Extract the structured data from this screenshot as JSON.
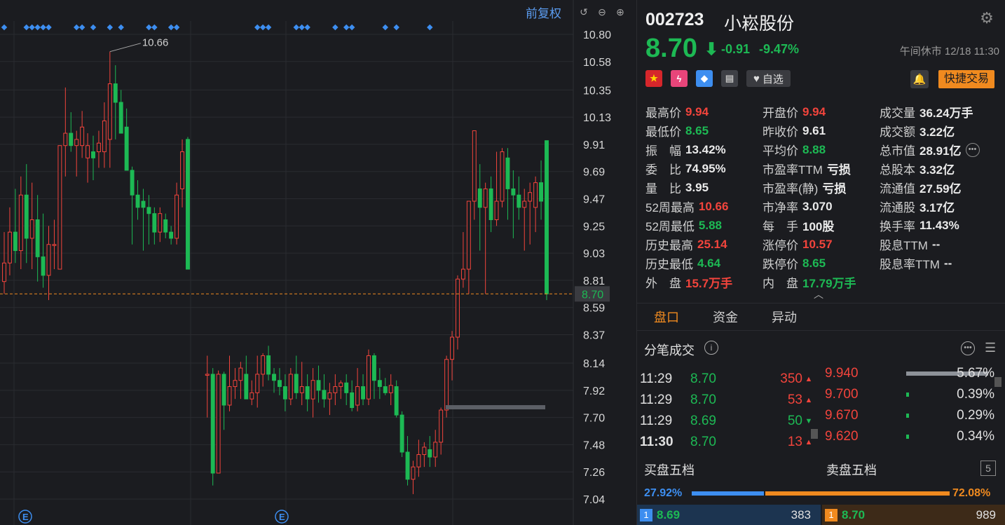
{
  "chart": {
    "toolbar": {
      "adjust_label": "前复权"
    },
    "y_ticks": [
      "10.80",
      "10.58",
      "10.35",
      "10.13",
      "9.91",
      "9.69",
      "9.47",
      "9.25",
      "9.03",
      "8.81",
      "8.59",
      "8.37",
      "8.14",
      "7.92",
      "7.70",
      "7.48",
      "7.26",
      "7.04"
    ],
    "current_price_label": "8.70",
    "high_annotation": "10.66",
    "event_marker": "E",
    "colors": {
      "up": "#f2443c",
      "down": "#1db954",
      "dot": "#3d8ef0"
    }
  },
  "chart_data": {
    "type": "candlestick",
    "ylim": [
      7.04,
      10.8
    ],
    "current_price": 8.7,
    "high_mark": 10.66,
    "candles": [
      {
        "o": 8.8,
        "h": 9.2,
        "l": 8.7,
        "c": 8.95
      },
      {
        "o": 8.95,
        "h": 9.4,
        "l": 8.85,
        "c": 9.2
      },
      {
        "o": 9.2,
        "h": 9.55,
        "l": 8.95,
        "c": 9.05
      },
      {
        "o": 9.05,
        "h": 9.65,
        "l": 8.9,
        "c": 9.5
      },
      {
        "o": 9.5,
        "h": 9.75,
        "l": 8.95,
        "c": 9.15
      },
      {
        "o": 9.15,
        "h": 9.6,
        "l": 8.9,
        "c": 9.3
      },
      {
        "o": 9.3,
        "h": 9.5,
        "l": 8.8,
        "c": 9.0
      },
      {
        "o": 9.0,
        "h": 9.35,
        "l": 8.75,
        "c": 8.85
      },
      {
        "o": 8.85,
        "h": 9.25,
        "l": 8.65,
        "c": 9.1
      },
      {
        "o": 9.1,
        "h": 9.3,
        "l": 8.9,
        "c": 9.1
      },
      {
        "o": 8.9,
        "h": 9.9,
        "l": 8.9,
        "c": 9.9
      },
      {
        "o": 9.9,
        "h": 10.37,
        "l": 9.65,
        "c": 10.0
      },
      {
        "o": 10.0,
        "h": 10.17,
        "l": 9.85,
        "c": 9.9
      },
      {
        "o": 9.9,
        "h": 10.02,
        "l": 9.65,
        "c": 9.95
      },
      {
        "o": 9.9,
        "h": 10.18,
        "l": 9.8,
        "c": 10.05
      },
      {
        "o": 9.8,
        "h": 10.0,
        "l": 9.6,
        "c": 9.9
      },
      {
        "o": 9.85,
        "h": 9.98,
        "l": 9.62,
        "c": 9.8
      },
      {
        "o": 9.85,
        "h": 10.02,
        "l": 9.72,
        "c": 9.92
      },
      {
        "o": 9.85,
        "h": 10.25,
        "l": 9.72,
        "c": 10.1
      },
      {
        "o": 9.95,
        "h": 10.66,
        "l": 9.72,
        "c": 10.4
      },
      {
        "o": 10.4,
        "h": 10.55,
        "l": 9.95,
        "c": 10.25
      },
      {
        "o": 10.25,
        "h": 10.35,
        "l": 10.0,
        "c": 10.0
      },
      {
        "o": 10.05,
        "h": 10.2,
        "l": 9.8,
        "c": 9.7
      },
      {
        "o": 9.7,
        "h": 9.73,
        "l": 9.1,
        "c": 9.5
      },
      {
        "o": 9.5,
        "h": 9.62,
        "l": 9.3,
        "c": 9.4
      },
      {
        "o": 9.45,
        "h": 9.55,
        "l": 9.05,
        "c": 9.4
      },
      {
        "o": 9.4,
        "h": 9.5,
        "l": 9.1,
        "c": 9.35
      },
      {
        "o": 9.35,
        "h": 9.4,
        "l": 9.1,
        "c": 9.2
      },
      {
        "o": 9.2,
        "h": 9.4,
        "l": 9.12,
        "c": 9.35
      },
      {
        "o": 9.3,
        "h": 9.35,
        "l": 9.15,
        "c": 9.2
      },
      {
        "o": 9.2,
        "h": 9.25,
        "l": 9.1,
        "c": 9.15
      },
      {
        "o": 9.15,
        "h": 9.6,
        "l": 9.1,
        "c": 9.5
      },
      {
        "o": 9.55,
        "h": 9.95,
        "l": 9.4,
        "c": 9.85
      },
      {
        "o": 9.95,
        "h": 9.97,
        "l": 8.9,
        "c": 8.9
      },
      {
        "o": 8.05,
        "h": 8.2,
        "l": 7.7,
        "c": 8.05
      },
      {
        "o": 8.05,
        "h": 8.1,
        "l": 7.15,
        "c": 7.25
      },
      {
        "o": 7.25,
        "h": 8.08,
        "l": 7.55,
        "c": 8.05
      },
      {
        "o": 8.05,
        "h": 8.07,
        "l": 7.6,
        "c": 7.8
      },
      {
        "o": 7.8,
        "h": 8.2,
        "l": 7.75,
        "c": 7.95
      },
      {
        "o": 7.95,
        "h": 8.1,
        "l": 7.85,
        "c": 8.0
      },
      {
        "o": 8.0,
        "h": 8.15,
        "l": 7.85,
        "c": 8.1
      },
      {
        "o": 8.05,
        "h": 8.2,
        "l": 7.88,
        "c": 7.85
      },
      {
        "o": 7.85,
        "h": 8.0,
        "l": 7.8,
        "c": 7.9
      },
      {
        "o": 7.9,
        "h": 8.2,
        "l": 7.78,
        "c": 8.05
      },
      {
        "o": 8.05,
        "h": 8.22,
        "l": 7.95,
        "c": 8.2
      },
      {
        "o": 8.2,
        "h": 8.28,
        "l": 8.0,
        "c": 8.05
      },
      {
        "o": 8.05,
        "h": 8.1,
        "l": 7.9,
        "c": 8.0
      },
      {
        "o": 8.0,
        "h": 8.1,
        "l": 7.88,
        "c": 7.95
      },
      {
        "o": 7.95,
        "h": 8.05,
        "l": 7.75,
        "c": 7.85
      },
      {
        "o": 7.85,
        "h": 8.1,
        "l": 7.8,
        "c": 8.05
      },
      {
        "o": 8.05,
        "h": 8.2,
        "l": 7.85,
        "c": 7.9
      },
      {
        "o": 7.9,
        "h": 8.15,
        "l": 7.8,
        "c": 7.95
      },
      {
        "o": 7.95,
        "h": 8.05,
        "l": 7.75,
        "c": 7.85
      },
      {
        "o": 7.85,
        "h": 8.1,
        "l": 7.7,
        "c": 8.0
      },
      {
        "o": 8.0,
        "h": 8.12,
        "l": 7.82,
        "c": 7.92
      },
      {
        "o": 7.92,
        "h": 8.05,
        "l": 7.78,
        "c": 7.85
      },
      {
        "o": 7.85,
        "h": 7.98,
        "l": 7.72,
        "c": 7.9
      },
      {
        "o": 7.9,
        "h": 8.05,
        "l": 7.8,
        "c": 7.95
      },
      {
        "o": 7.95,
        "h": 8.0,
        "l": 7.85,
        "c": 7.98
      },
      {
        "o": 7.98,
        "h": 8.05,
        "l": 7.8,
        "c": 7.9
      },
      {
        "o": 7.9,
        "h": 8.0,
        "l": 7.75,
        "c": 7.78
      },
      {
        "o": 7.8,
        "h": 8.1,
        "l": 7.75,
        "c": 7.95
      },
      {
        "o": 7.95,
        "h": 8.05,
        "l": 7.8,
        "c": 7.85
      },
      {
        "o": 7.85,
        "h": 8.25,
        "l": 7.8,
        "c": 8.2
      },
      {
        "o": 8.2,
        "h": 8.22,
        "l": 7.85,
        "c": 8.0
      },
      {
        "o": 8.0,
        "h": 8.1,
        "l": 7.85,
        "c": 7.95
      },
      {
        "o": 7.95,
        "h": 8.02,
        "l": 7.88,
        "c": 7.9
      },
      {
        "o": 7.9,
        "h": 8.05,
        "l": 7.8,
        "c": 7.96
      },
      {
        "o": 7.95,
        "h": 8.0,
        "l": 7.7,
        "c": 7.72
      },
      {
        "o": 7.72,
        "h": 7.75,
        "l": 7.38,
        "c": 7.42
      },
      {
        "o": 7.42,
        "h": 7.55,
        "l": 7.15,
        "c": 7.2
      },
      {
        "o": 7.2,
        "h": 7.35,
        "l": 7.08,
        "c": 7.3
      },
      {
        "o": 7.3,
        "h": 7.52,
        "l": 7.22,
        "c": 7.4
      },
      {
        "o": 7.4,
        "h": 7.5,
        "l": 7.3,
        "c": 7.46
      },
      {
        "o": 7.44,
        "h": 7.55,
        "l": 7.3,
        "c": 7.38
      },
      {
        "o": 7.38,
        "h": 7.6,
        "l": 7.3,
        "c": 7.5
      },
      {
        "o": 7.5,
        "h": 7.78,
        "l": 7.4,
        "c": 7.76
      },
      {
        "o": 7.76,
        "h": 8.2,
        "l": 7.7,
        "c": 8.17
      },
      {
        "o": 8.17,
        "h": 8.4,
        "l": 8.0,
        "c": 8.35
      },
      {
        "o": 8.35,
        "h": 8.85,
        "l": 8.25,
        "c": 8.82
      },
      {
        "o": 8.82,
        "h": 9.2,
        "l": 8.75,
        "c": 8.9
      },
      {
        "o": 8.9,
        "h": 9.45,
        "l": 8.7,
        "c": 9.45
      },
      {
        "o": 9.45,
        "h": 10.02,
        "l": 9.3,
        "c": 10.02
      },
      {
        "o": 9.55,
        "h": 9.75,
        "l": 9.05,
        "c": 9.4
      },
      {
        "o": 9.4,
        "h": 9.6,
        "l": 8.7,
        "c": 9.55
      },
      {
        "o": 9.55,
        "h": 9.65,
        "l": 9.2,
        "c": 9.3
      },
      {
        "o": 9.3,
        "h": 9.85,
        "l": 9.25,
        "c": 9.45
      },
      {
        "o": 9.45,
        "h": 9.88,
        "l": 9.4,
        "c": 9.85
      },
      {
        "o": 9.8,
        "h": 9.88,
        "l": 9.3,
        "c": 9.55
      },
      {
        "o": 9.55,
        "h": 9.7,
        "l": 9.15,
        "c": 9.5
      },
      {
        "o": 9.5,
        "h": 9.65,
        "l": 9.3,
        "c": 9.4
      },
      {
        "o": 9.4,
        "h": 9.55,
        "l": 9.05,
        "c": 9.45
      },
      {
        "o": 9.45,
        "h": 9.6,
        "l": 9.1,
        "c": 9.52
      },
      {
        "o": 9.4,
        "h": 9.65,
        "l": 9.2,
        "c": 9.6
      },
      {
        "o": 9.6,
        "h": 9.78,
        "l": 9.3,
        "c": 9.45
      },
      {
        "o": 9.94,
        "h": 9.94,
        "l": 8.65,
        "c": 8.7
      }
    ],
    "gap_after": 33,
    "dot_markers": [
      0,
      4,
      5,
      6,
      7,
      8,
      13,
      14,
      16,
      19,
      21,
      26,
      27,
      30,
      31,
      43,
      44,
      45,
      50,
      51,
      52,
      57,
      59,
      60,
      66,
      68,
      74
    ]
  },
  "header": {
    "code": "002723",
    "name": "小崧股份",
    "price": "8.70",
    "arrow": "⬇",
    "change": "-0.91",
    "pct_change": "-9.47%",
    "status": "午间休市 12/18 11:30",
    "favorite_label": "自选",
    "quick_trade_label": "快捷交易"
  },
  "stats": {
    "high_lbl": "最高价",
    "high": "9.94",
    "open_lbl": "开盘价",
    "open": "9.94",
    "vol_lbl": "成交量",
    "vol": "36.24万手",
    "low_lbl": "最低价",
    "low": "8.65",
    "prev_lbl": "昨收价",
    "prev": "9.61",
    "amt_lbl": "成交额",
    "amt": "3.22亿",
    "amp_lbl": "振　幅",
    "amp": "13.42%",
    "avg_lbl": "平均价",
    "avg": "8.88",
    "mcap_lbl": "总市值",
    "mcap": "28.91亿",
    "wb_lbl": "委　比",
    "wb": "74.95%",
    "pe_ttm_lbl": "市盈率TTM",
    "pe_ttm": "亏损",
    "shares_lbl": "总股本",
    "shares": "3.32亿",
    "lb_lbl": "量　比",
    "lb": "3.95",
    "pe_static_lbl": "市盈率(静)",
    "pe_static": "亏损",
    "float_val_lbl": "流通值",
    "float_val": "27.59亿",
    "h52_lbl": "52周最高",
    "h52": "10.66",
    "pb_lbl": "市净率",
    "pb": "3.070",
    "float_sh_lbl": "流通股",
    "float_sh": "3.17亿",
    "l52_lbl": "52周最低",
    "l52": "5.88",
    "lot_lbl": "每　手",
    "lot": "100股",
    "turnover_lbl": "换手率",
    "turnover": "11.43%",
    "hist_h_lbl": "历史最高",
    "hist_h": "25.14",
    "limit_up_lbl": "涨停价",
    "limit_up": "10.57",
    "div_lbl": "股息TTM",
    "div": "--",
    "hist_l_lbl": "历史最低",
    "hist_l": "4.64",
    "limit_dn_lbl": "跌停价",
    "limit_dn": "8.65",
    "div_rate_lbl": "股息率TTM",
    "div_rate": "--",
    "outer_lbl": "外　盘",
    "outer": "15.7万手",
    "inner_lbl": "内　盘",
    "inner": "17.79万手"
  },
  "tabs": [
    "盘口",
    "资金",
    "异动"
  ],
  "ticks": {
    "title": "分笔成交",
    "rows": [
      {
        "time": "11:29",
        "price": "8.70",
        "vol": "350",
        "dir": "up"
      },
      {
        "time": "11:29",
        "price": "8.70",
        "vol": "53",
        "dir": "up"
      },
      {
        "time": "11:29",
        "price": "8.69",
        "vol": "50",
        "dir": "down"
      },
      {
        "time": "11:30",
        "price": "8.70",
        "vol": "13",
        "dir": "up"
      }
    ]
  },
  "distribution": [
    {
      "price": "9.940",
      "pct": "5.67%",
      "fill": 0.9
    },
    {
      "price": "9.700",
      "pct": "0.39%",
      "fill": 0.03
    },
    {
      "price": "9.670",
      "pct": "0.29%",
      "fill": 0.03
    },
    {
      "price": "9.620",
      "pct": "0.34%",
      "fill": 0.03
    }
  ],
  "orderbook": {
    "buy_title": "买盘五档",
    "sell_title": "卖盘五档",
    "levels_label": "5",
    "buy_pct": "27.92%",
    "sell_pct": "72.08%",
    "buy_ratio": 0.2792,
    "buy_row": {
      "level": "1",
      "price": "8.69",
      "vol": "383"
    },
    "sell_row": {
      "level": "1",
      "price": "8.70",
      "vol": "989"
    }
  }
}
